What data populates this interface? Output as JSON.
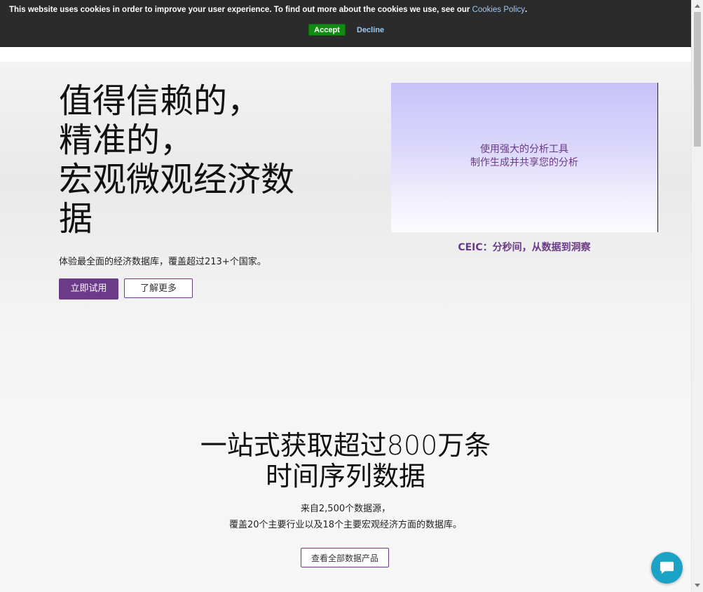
{
  "cookie_banner": {
    "message": "This website uses cookies in order to improve your user experience. To find out more about the cookies we use, see our ",
    "policy_link": "Cookies Policy",
    "period": ".",
    "accept_label": "Accept",
    "decline_label": "Decline"
  },
  "hero": {
    "title_lines": [
      "值得信赖的，",
      "精准的，",
      "宏观微观经济数",
      "据"
    ],
    "subtitle": "体验最全面的经济数据库，覆盖超过213+个国家。",
    "primary_button": "立即试用",
    "secondary_button": "了解更多"
  },
  "video": {
    "caption_lines": [
      "使用强大的分析工具",
      "制作生成并共享您的分析"
    ],
    "tagline": "CEIC：分秒间，从数据到洞察"
  },
  "section2": {
    "title_lines": [
      "一站式获取超过800万条",
      "时间序列数据"
    ],
    "desc_lines": [
      "来自2,500个数据源，",
      "覆盖20个主要行业以及18个主要宏观经济方面的数据库。"
    ],
    "button": "查看全部数据产品"
  },
  "chat": {
    "icon": "chat-bubble-icon",
    "color": "#1aa3c4"
  },
  "colors": {
    "brand_purple": "#6b3a88",
    "accept_green": "#138a13",
    "banner_bg": "#2b2b2b"
  }
}
